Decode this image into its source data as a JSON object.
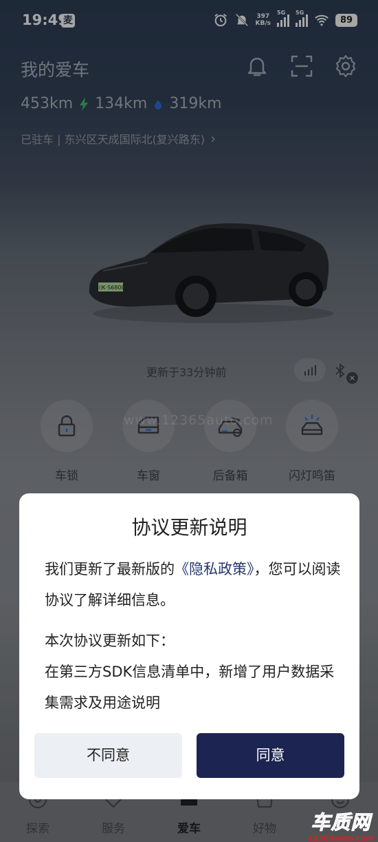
{
  "status_bar": {
    "time": "19:49",
    "app_badge": "麦",
    "speed_value": "397",
    "speed_unit": "KB/s",
    "net1": "5G",
    "net2": "5G",
    "battery": "89"
  },
  "header": {
    "title": "我的爱车",
    "icons": [
      "bell-icon",
      "scan-icon",
      "gear-icon"
    ]
  },
  "ranges": {
    "total": "453km",
    "electric": "134km",
    "fuel": "319km",
    "electric_color": "#3fbf6a",
    "fuel_color": "#2f6fd6"
  },
  "location": {
    "text": "已驻车 | 东兴区天成国际北(复兴路东)",
    "chevron": "›"
  },
  "car": {
    "plate": "川K·S6800"
  },
  "vehicle_status": {
    "updated": "更新于33分钟前",
    "close_glyph": "×"
  },
  "controls": [
    {
      "label": "车锁",
      "icon": "lock-icon"
    },
    {
      "label": "车窗",
      "icon": "window-icon"
    },
    {
      "label": "后备箱",
      "icon": "trunk-icon"
    },
    {
      "label": "闪灯鸣笛",
      "icon": "flash-horn-icon"
    }
  ],
  "watermark": "www.12365auto.com",
  "tabs": [
    {
      "label": "探索",
      "icon": "explore-icon",
      "active": false
    },
    {
      "label": "服务",
      "icon": "service-icon",
      "active": false
    },
    {
      "label": "爱车",
      "icon": "car-icon",
      "active": true
    },
    {
      "label": "好物",
      "icon": "shop-icon",
      "active": false
    },
    {
      "label": "",
      "icon": "profile-icon",
      "active": false
    }
  ],
  "brand_logo": {
    "name": "车质网",
    "url": "12365auto.com"
  },
  "dialog": {
    "title": "协议更新说明",
    "p1_before": "我们更新了最新版的",
    "p1_link": "《隐私政策》",
    "p1_after": "，您可以阅读协议了解详细信息。",
    "p2_heading": "本次协议更新如下：",
    "p2_body": "在第三方SDK信息清单中，新增了用户数据采集需求及用途说明",
    "disagree_label": "不同意",
    "agree_label": "同意",
    "accent_color": "#1c2452"
  },
  "overlay_color": "rgba(0,0,0,0.35)"
}
